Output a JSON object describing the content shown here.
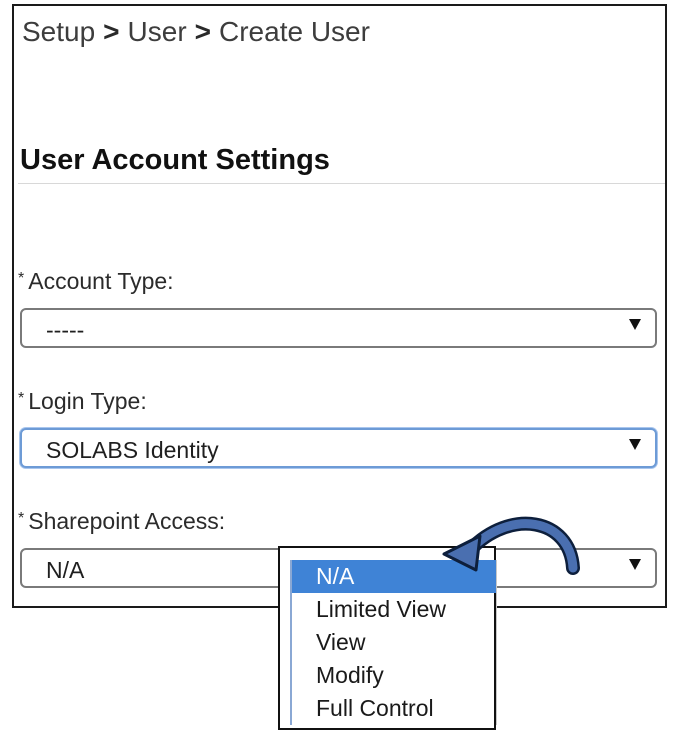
{
  "breadcrumb": {
    "items": [
      "Setup",
      "User",
      "Create User"
    ],
    "separator": ">"
  },
  "section": {
    "title": "User Account Settings"
  },
  "fields": [
    {
      "required_mark": "*",
      "label": "Account Type:",
      "value": "-----"
    },
    {
      "required_mark": "*",
      "label": "Login Type:",
      "value": "SOLABS Identity"
    },
    {
      "required_mark": "*",
      "label": "Sharepoint Access:",
      "value": "N/A"
    }
  ],
  "sharepoint_dropdown": {
    "options": [
      "N/A",
      "Limited View",
      "View",
      "Modify",
      "Full Control"
    ],
    "selected": "N/A"
  },
  "colors": {
    "highlight": "#3f83d6",
    "focus_border": "#6d9bd6",
    "callout_arrow": "#4a6fb0"
  },
  "icons": {
    "caret": "caret-down-icon",
    "callout": "curved-arrow-icon"
  }
}
